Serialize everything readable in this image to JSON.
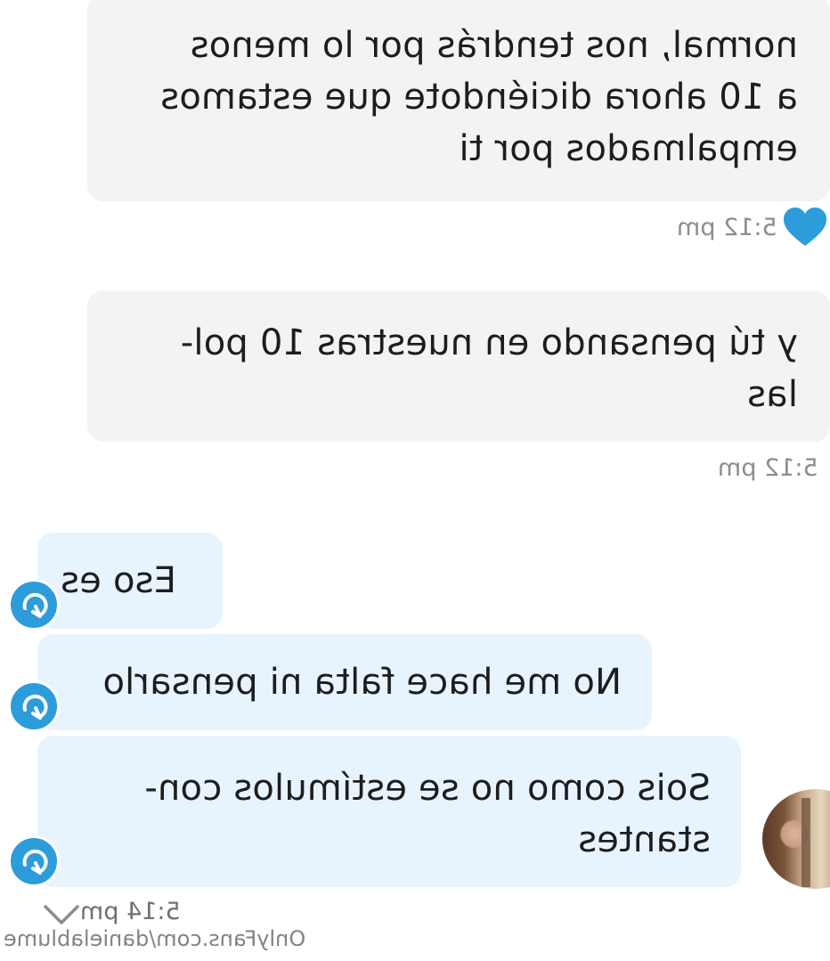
{
  "messages": {
    "m1": {
      "text": "normal, nos tendrás por lo menos\na 10 ahora diciéndote que estamos\nempalmados por ti",
      "time": "5:12 pm"
    },
    "m2": {
      "text": "y tú pensando en nuestras 10 pol-\nlas",
      "time": "5:12 pm"
    },
    "m3": {
      "text": "Eso es"
    },
    "m4": {
      "text": "No me hace falta ni pensarlo"
    },
    "m5": {
      "text": "Sois como no se estímulos con-\nstantes",
      "time": "5:14 pm"
    }
  },
  "watermark": "OnlyFans.com/danielablume",
  "colors": {
    "incoming_bubble": "#f2f3f5",
    "outgoing_bubble": "#e8f4fd",
    "accent": "#2c9cdb",
    "heart": "#2c9cdb"
  },
  "icons": [
    "heart-icon",
    "reply-icon",
    "chevron-down-icon",
    "avatar"
  ]
}
